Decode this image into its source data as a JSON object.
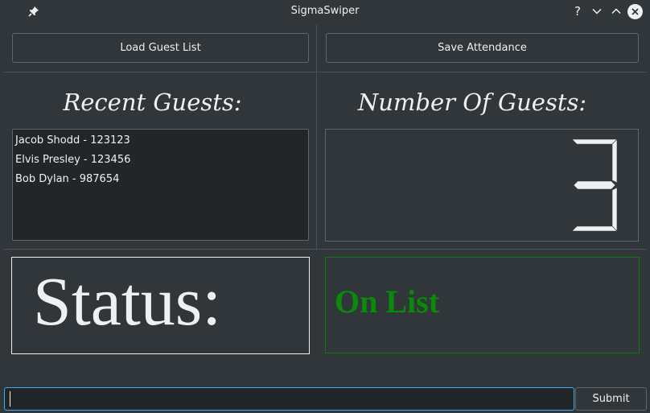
{
  "titlebar": {
    "title": "SigmaSwiper",
    "pin_icon": "pin-icon",
    "help_label": "?",
    "minimize_icon": "chevron-down-icon",
    "maximize_icon": "chevron-up-icon",
    "close_icon": "close-icon"
  },
  "toolbar": {
    "load_label": "Load Guest List",
    "save_label": "Save Attendance"
  },
  "recent": {
    "heading": "Recent Guests:",
    "items": [
      "Jacob Shodd - 123123",
      "Elvis Presley - 123456",
      "Bob Dylan - 987654"
    ]
  },
  "count": {
    "heading": "Number Of Guests:",
    "value": 3
  },
  "status": {
    "label": "Status:",
    "result": "On List",
    "result_color": "#0a8a0a"
  },
  "entry": {
    "value": "",
    "submit_label": "Submit"
  },
  "colors": {
    "background": "#31363b",
    "accent": "#3daee9"
  }
}
